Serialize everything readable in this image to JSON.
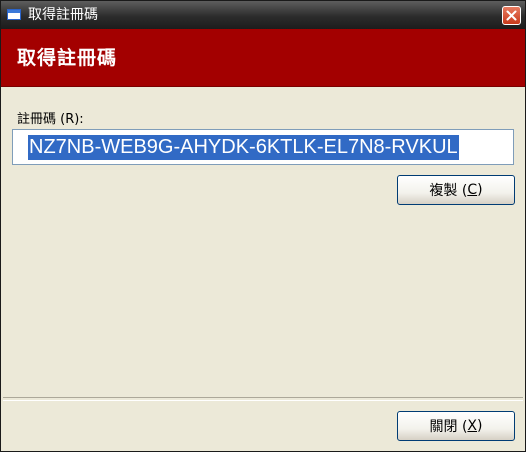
{
  "window": {
    "title": "取得註冊碼"
  },
  "banner": {
    "heading": "取得註冊碼"
  },
  "registration": {
    "label": "註冊碼 (R):",
    "code": "NZ7NB-WEB9G-AHYDK-6KTLK-EL7N8-RVKUL"
  },
  "buttons": {
    "copy_label": "複製 (",
    "copy_mnemonic": "C",
    "copy_suffix": ")",
    "close_label": "關閉 (",
    "close_mnemonic": "X",
    "close_suffix": ")"
  },
  "colors": {
    "banner": "#a30000",
    "selection": "#316ac5"
  },
  "icons": {
    "app": "window-icon",
    "close": "close-x-icon"
  }
}
